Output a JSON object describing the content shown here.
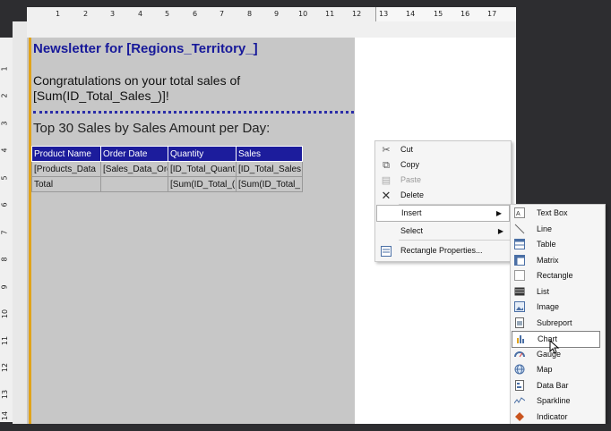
{
  "ruler": {
    "top_ticks": [
      "1",
      "2",
      "3",
      "4",
      "5",
      "6",
      "7",
      "8",
      "9",
      "10",
      "11",
      "12",
      "13",
      "14",
      "15",
      "16",
      "17"
    ],
    "left_ticks": [
      "1",
      "2",
      "3",
      "4",
      "5",
      "6",
      "7",
      "8",
      "9",
      "10",
      "11",
      "12",
      "13",
      "14"
    ]
  },
  "report": {
    "title": "Newsletter for [Regions_Territory_]",
    "congrats_line1": "Congratulations on your total sales of",
    "congrats_line2": "[Sum(ID_Total_Sales_)]!",
    "subtitle": "Top 30 Sales by Sales Amount per Day:",
    "table": {
      "headers": [
        "Product Name",
        "Order Date",
        "Quantity",
        "Sales"
      ],
      "rows": [
        [
          "[Products_Data",
          "[Sales_Data_Ord",
          "[ID_Total_Quant",
          "[ID_Total_Sales"
        ],
        [
          "Total",
          "",
          "[Sum(ID_Total_(",
          "[Sum(ID_Total_"
        ]
      ]
    }
  },
  "context_menu": {
    "items": [
      {
        "label": "Cut",
        "icon": "scissors-icon",
        "enabled": true
      },
      {
        "label": "Copy",
        "icon": "copy-icon",
        "enabled": true
      },
      {
        "label": "Paste",
        "icon": "paste-icon",
        "enabled": false
      },
      {
        "label": "Delete",
        "icon": "delete-icon",
        "enabled": true
      },
      {
        "label": "Insert",
        "icon": "",
        "enabled": true,
        "submenu": true
      },
      {
        "label": "Select",
        "icon": "",
        "enabled": true,
        "submenu": true
      },
      {
        "label": "Rectangle Properties...",
        "icon": "properties-icon",
        "enabled": true
      }
    ]
  },
  "insert_submenu": {
    "items": [
      {
        "label": "Text Box",
        "icon": "textbox-icon"
      },
      {
        "label": "Line",
        "icon": "line-icon"
      },
      {
        "label": "Table",
        "icon": "table-icon"
      },
      {
        "label": "Matrix",
        "icon": "matrix-icon"
      },
      {
        "label": "Rectangle",
        "icon": "rectangle-icon"
      },
      {
        "label": "List",
        "icon": "list-icon"
      },
      {
        "label": "Image",
        "icon": "image-icon"
      },
      {
        "label": "Subreport",
        "icon": "subreport-icon"
      },
      {
        "label": "Chart",
        "icon": "chart-icon"
      },
      {
        "label": "Gauge",
        "icon": "gauge-icon"
      },
      {
        "label": "Map",
        "icon": "map-icon"
      },
      {
        "label": "Data Bar",
        "icon": "databar-icon"
      },
      {
        "label": "Sparkline",
        "icon": "sparkline-icon"
      },
      {
        "label": "Indicator",
        "icon": "indicator-icon"
      }
    ],
    "highlighted": "Chart"
  }
}
